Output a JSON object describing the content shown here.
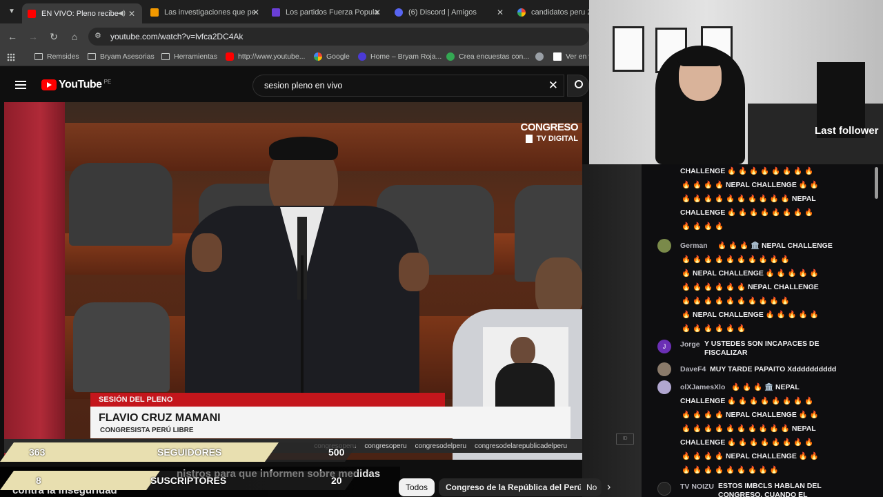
{
  "browser": {
    "tabs": [
      {
        "label": "EN VIVO: Pleno recibe",
        "active": true
      },
      {
        "label": "Las investigaciones que pe"
      },
      {
        "label": "Los partidos Fuerza Popula"
      },
      {
        "label": "(6) Discord | Amigos"
      },
      {
        "label": "candidatos peru 20"
      }
    ],
    "url": "youtube.com/watch?v=lvfca2DC4Ak",
    "bookmarks": [
      "Remsides",
      "Bryam Asesorias",
      "Herramientas",
      "http://www.youtube...",
      "Google",
      "Home – Bryam Roja...",
      "Crea encuestas con...",
      "Ver en v"
    ]
  },
  "youtube": {
    "logo": "YouTube",
    "region": "PE",
    "search_query": "sesion pleno en vivo"
  },
  "video": {
    "channel_bug_top": "CONGRESO",
    "channel_bug_bottom": "TV DIGITAL",
    "lower_third_tag": "SESIÓN DEL PLENO",
    "speaker_name": "FLAVIO CRUZ MAMANI",
    "speaker_role": "CONGRESISTA PERÚ LIBRE",
    "social_handles": [
      "congresoperu",
      "congresoperu",
      "congresodelperu",
      "congresodelarepublicadelperu"
    ]
  },
  "stream_overlay": {
    "followers_count": "363",
    "followers_label": "SEGUIDORES",
    "followers_goal": "500",
    "subs_count": "8",
    "subs_label": "SUSCRIPTORES",
    "subs_goal": "20",
    "title_line1": "nistros para que informen sobre medidas",
    "title_line2": "contra la inseguridad",
    "last_follower_label": "Last follower"
  },
  "chips": [
    "Todos",
    "Congreso de la República del Perú",
    "No"
  ],
  "chat": {
    "messages": [
      {
        "user": "",
        "text": "CHALLENGE 🔥 🔥 🔥 🔥 🔥 🔥 🔥 🔥"
      },
      {
        "user": "",
        "text": "🔥 🔥 🔥 🔥 NEPAL CHALLENGE 🔥 🔥"
      },
      {
        "user": "",
        "text": "🔥 🔥 🔥 🔥 🔥 🔥 🔥 🔥 🔥 🔥 NEPAL"
      },
      {
        "user": "",
        "text": "CHALLENGE 🔥 🔥 🔥 🔥 🔥 🔥 🔥 🔥"
      },
      {
        "user": "",
        "text": "🔥 🔥 🔥 🔥"
      },
      {
        "user": "German",
        "text": "🔥 🔥 🔥 🏛️ NEPAL CHALLENGE"
      },
      {
        "user": "",
        "text": "🔥 🔥 🔥 🔥 🔥 🔥 🔥 🔥 🔥 🔥"
      },
      {
        "user": "",
        "text": "🔥 NEPAL CHALLENGE 🔥 🔥 🔥 🔥 🔥"
      },
      {
        "user": "",
        "text": "🔥 🔥 🔥 🔥 🔥 🔥 NEPAL CHALLENGE"
      },
      {
        "user": "",
        "text": "🔥 🔥 🔥 🔥 🔥 🔥 🔥 🔥 🔥 🔥"
      },
      {
        "user": "",
        "text": "🔥 NEPAL CHALLENGE 🔥 🔥 🔥 🔥 🔥"
      },
      {
        "user": "",
        "text": "🔥 🔥 🔥 🔥 🔥 🔥"
      },
      {
        "user": "Jorge",
        "text": "Y USTEDES SON INCAPACES DE FISCALIZAR"
      },
      {
        "user": "DaveF4",
        "text": "MUY TARDE PAPAITO Xdddddddddd"
      },
      {
        "user": "olXJamesXlo",
        "text": "🔥 🔥 🔥 🏛️ NEPAL"
      },
      {
        "user": "",
        "text": "CHALLENGE 🔥 🔥 🔥 🔥 🔥 🔥 🔥 🔥"
      },
      {
        "user": "",
        "text": "🔥 🔥 🔥 🔥 NEPAL CHALLENGE 🔥 🔥"
      },
      {
        "user": "",
        "text": "🔥 🔥 🔥 🔥 🔥 🔥 🔥 🔥 🔥 🔥 NEPAL"
      },
      {
        "user": "",
        "text": "CHALLENGE 🔥 🔥 🔥 🔥 🔥 🔥 🔥 🔥"
      },
      {
        "user": "",
        "text": "🔥 🔥 🔥 🔥 NEPAL CHALLENGE 🔥 🔥"
      },
      {
        "user": "",
        "text": "🔥 🔥 🔥 🔥 🔥 🔥 🔥 🔥 🔥"
      },
      {
        "user": "TV NOIZU",
        "text": "ESTOS IMBCLS HABLAN DEL CONGRESO, CUANDO EL PROBLEMA ES DINA"
      }
    ]
  },
  "colors": {
    "accent_red": "#c4161c",
    "youtube_red": "#ff0000",
    "overlay_gold": "#e8dfb0",
    "chat_bg": "#0e0e10"
  }
}
